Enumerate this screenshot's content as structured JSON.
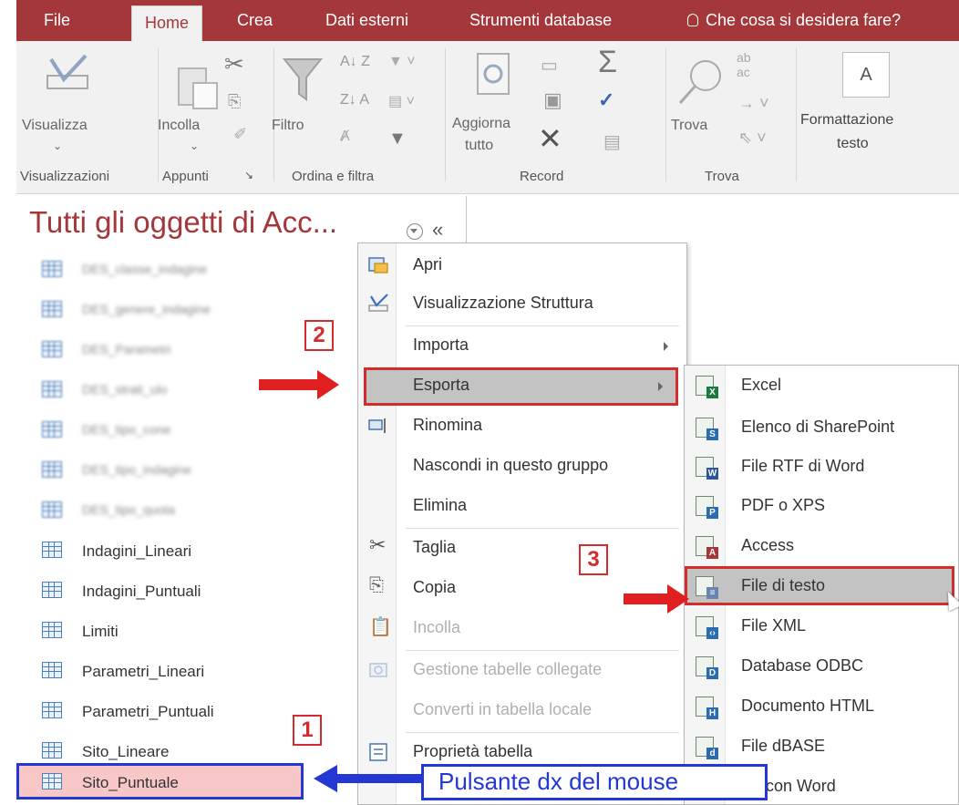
{
  "tabs": {
    "file": "File",
    "home": "Home",
    "crea": "Crea",
    "dati_esterni": "Dati esterni",
    "strumenti": "Strumenti database",
    "search": "Che cosa si desidera fare?"
  },
  "ribbon": {
    "visualizza": "Visualizza",
    "incolla": "Incolla",
    "filtro": "Filtro",
    "aggiorna_1": "Aggiorna",
    "aggiorna_2": "tutto",
    "trova": "Trova",
    "formattazione_1": "Formattazione",
    "formattazione_2": "testo",
    "groups": {
      "visualizzazioni": "Visualizzazioni",
      "appunti": "Appunti",
      "ordina": "Ordina e filtra",
      "record": "Record",
      "trova": "Trova"
    }
  },
  "nav": {
    "title": "Tutti gli oggetti di Acc...",
    "collapse": "«",
    "items": [
      "DES_classe_indagine",
      "DES_genere_indagine",
      "DES_Parametri",
      "DES_strati_ulo",
      "DES_tipo_cone",
      "DES_tipo_indagine",
      "DES_tipo_quota",
      "Indagini_Lineari",
      "Indagini_Puntuali",
      "Limiti",
      "Parametri_Lineari",
      "Parametri_Puntuali",
      "Sito_Lineare",
      "Sito_Puntuale"
    ]
  },
  "context_menu": {
    "apri": "Apri",
    "struttura": "Visualizzazione Struttura",
    "importa": "Importa",
    "esporta": "Esporta",
    "rinomina": "Rinomina",
    "nascondi": "Nascondi in questo gruppo",
    "elimina": "Elimina",
    "taglia": "Taglia",
    "copia": "Copia",
    "incolla": "Incolla",
    "gestione": "Gestione tabelle collegate",
    "converti": "Converti in tabella locale",
    "proprieta": "Proprietà tabella"
  },
  "submenu": {
    "excel": "Excel",
    "sharepoint": "Elenco di SharePoint",
    "rtf": "File RTF di Word",
    "pdf": "PDF o XPS",
    "access": "Access",
    "testo": "File di testo",
    "xml": "File XML",
    "odbc": "Database ODBC",
    "html": "Documento HTML",
    "dbase": "File dBASE",
    "word": "sci con Word"
  },
  "annotations": {
    "step1": "1",
    "step2": "2",
    "step3": "3",
    "mouse_callout": "Pulsante dx del mouse"
  }
}
